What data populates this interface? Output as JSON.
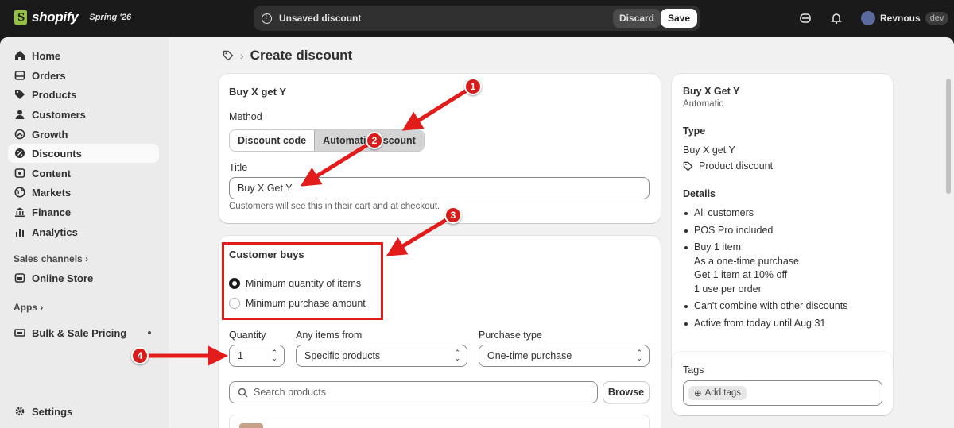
{
  "topbar": {
    "brand": "shopify",
    "edition": "Spring '26",
    "unsaved_label": "Unsaved discount",
    "discard_label": "Discard",
    "save_label": "Save",
    "user_name": "Revnous",
    "store_badge": "dev"
  },
  "sidebar": {
    "items": [
      {
        "label": "Home",
        "icon": "home-icon"
      },
      {
        "label": "Orders",
        "icon": "orders-icon"
      },
      {
        "label": "Products",
        "icon": "tag-icon"
      },
      {
        "label": "Customers",
        "icon": "person-icon"
      },
      {
        "label": "Growth",
        "icon": "growth-icon"
      },
      {
        "label": "Discounts",
        "icon": "discount-icon"
      },
      {
        "label": "Content",
        "icon": "content-icon"
      },
      {
        "label": "Markets",
        "icon": "globe-icon"
      },
      {
        "label": "Finance",
        "icon": "bank-icon"
      },
      {
        "label": "Analytics",
        "icon": "chart-icon"
      }
    ],
    "active": "Discounts",
    "sales_channels_label": "Sales channels",
    "online_store_label": "Online Store",
    "apps_label": "Apps",
    "bulk_label": "Bulk & Sale Pricing",
    "settings_label": "Settings"
  },
  "page": {
    "title": "Create discount"
  },
  "method_card": {
    "heading": "Buy X get Y",
    "method_label": "Method",
    "method_options": [
      "Discount code",
      "Automatic discount"
    ],
    "method_selected": "Automatic discount",
    "title_label": "Title",
    "title_value": "Buy X Get Y",
    "title_help": "Customers will see this in their cart and at checkout."
  },
  "buys_card": {
    "heading": "Customer buys",
    "options": [
      "Minimum quantity of items",
      "Minimum purchase amount"
    ],
    "selected": "Minimum quantity of items",
    "quantity_label": "Quantity",
    "quantity_value": "1",
    "items_label": "Any items from",
    "items_value": "Specific products",
    "purchase_label": "Purchase type",
    "purchase_value": "One-time purchase",
    "search_placeholder": "Search products",
    "browse_label": "Browse"
  },
  "summary": {
    "title": "Buy X Get Y",
    "subtitle": "Automatic",
    "type_label": "Type",
    "type_name": "Buy X get Y",
    "type_kind": "Product discount",
    "details_label": "Details",
    "details": [
      "All customers",
      "POS Pro included",
      "Buy 1 item",
      "As a one-time purchase",
      "Get 1 item at 10% off",
      "1 use per order",
      "Can't combine with other discounts",
      "Active from today until Aug 31"
    ]
  },
  "tags_card": {
    "label": "Tags",
    "add_label": "Add tags"
  },
  "annotations": {
    "badges": [
      "1",
      "2",
      "3",
      "4"
    ],
    "color": "#d81b1b"
  }
}
